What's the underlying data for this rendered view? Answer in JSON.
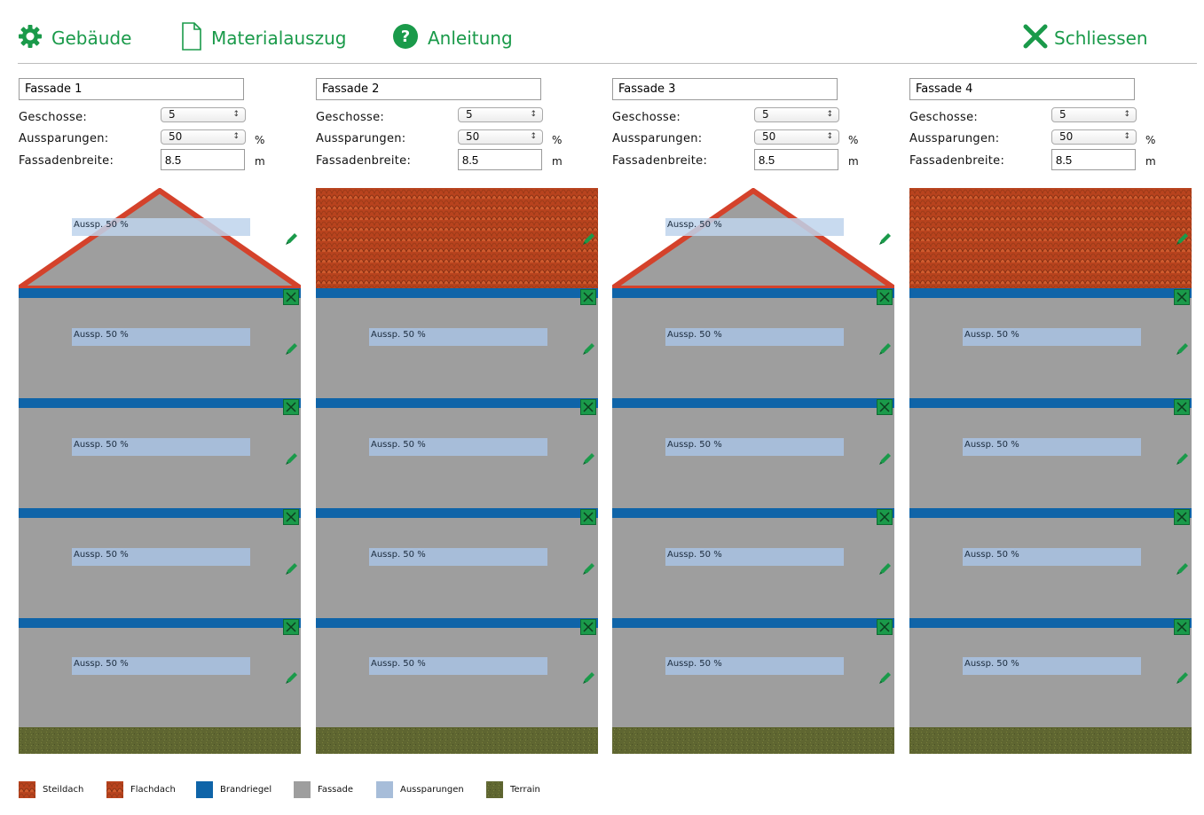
{
  "toolbar": {
    "building_label": "Gebäude",
    "material_label": "Materialauszug",
    "help_label": "Anleitung",
    "close_label": "Schliessen",
    "accent_color": "#1a9a4a"
  },
  "labels": {
    "floors": "Geschosse:",
    "cutouts": "Aussparungen:",
    "width": "Fassadenbreite:",
    "unit_percent": "%",
    "unit_meter": "m"
  },
  "facades": [
    {
      "name": "Fassade 1",
      "floors": "5",
      "cutouts": "50",
      "width": "8.5",
      "roof_type": "Steildach",
      "roof_cutout": "Aussp. 50 %",
      "floor_cutouts": [
        "Aussp. 50 %",
        "Aussp. 50 %",
        "Aussp. 50 %",
        "Aussp. 50 %",
        "Aussp. 50 %"
      ]
    },
    {
      "name": "Fassade 2",
      "floors": "5",
      "cutouts": "50",
      "width": "8.5",
      "roof_type": "Flachdach",
      "floor_cutouts": [
        "Aussp. 50 %",
        "Aussp. 50 %",
        "Aussp. 50 %",
        "Aussp. 50 %",
        "Aussp. 50 %"
      ]
    },
    {
      "name": "Fassade 3",
      "floors": "5",
      "cutouts": "50",
      "width": "8.5",
      "roof_type": "Steildach",
      "roof_cutout": "Aussp. 50 %",
      "floor_cutouts": [
        "Aussp. 50 %",
        "Aussp. 50 %",
        "Aussp. 50 %",
        "Aussp. 50 %",
        "Aussp. 50 %"
      ]
    },
    {
      "name": "Fassade 4",
      "floors": "5",
      "cutouts": "50",
      "width": "8.5",
      "roof_type": "Flachdach",
      "floor_cutouts": [
        "Aussp. 50 %",
        "Aussp. 50 %",
        "Aussp. 50 %",
        "Aussp. 50 %",
        "Aussp. 50 %"
      ]
    }
  ],
  "legend": [
    {
      "label": "Steildach",
      "color": "#c2512a"
    },
    {
      "label": "Flachdach",
      "color": "#a9552e"
    },
    {
      "label": "Brandriegel",
      "color": "#0f64a8"
    },
    {
      "label": "Fassade",
      "color": "#9e9e9e"
    },
    {
      "label": "Aussparungen",
      "color": "#a7bdd9"
    },
    {
      "label": "Terrain",
      "color": "#5e6430"
    }
  ],
  "colors": {
    "facade": "#9e9e9e",
    "roof_outline": "#d4422b",
    "fire_barrier": "#0f64a8",
    "terrain": "#5e6430",
    "tile": "#c24a22"
  }
}
